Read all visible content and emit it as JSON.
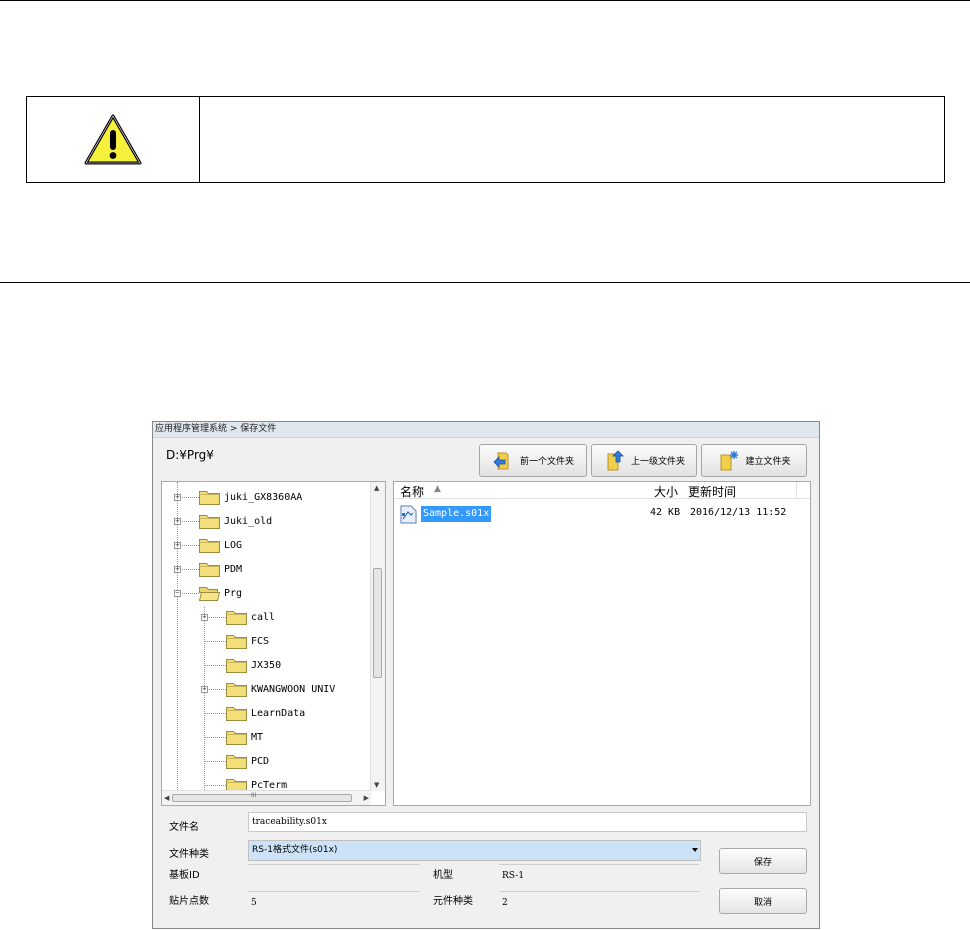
{
  "dialog": {
    "title": "应用程序管理系统 > 保存文件",
    "current_path": "D:¥Prg¥",
    "toolbar": {
      "back_label": "前一个文件夹",
      "up_label": "上一级文件夹",
      "new_folder_label": "建立文件夹"
    },
    "tree": {
      "items": [
        {
          "label": "juki_GX8360AA"
        },
        {
          "label": "Juki_old"
        },
        {
          "label": "LOG"
        },
        {
          "label": "PDM"
        },
        {
          "label": "Prg"
        },
        {
          "label": "call"
        },
        {
          "label": "FCS"
        },
        {
          "label": "JX350"
        },
        {
          "label": "KWANGWOON UNIV"
        },
        {
          "label": "LearnData"
        },
        {
          "label": "MT"
        },
        {
          "label": "PCD"
        },
        {
          "label": "PcTerm"
        }
      ],
      "hscroll_marker": "III"
    },
    "file_list": {
      "columns": {
        "name": "名称",
        "size": "大小",
        "modified": "更新时间"
      },
      "files": [
        {
          "name": "Sample.s01x",
          "size": "42 KB",
          "modified": "2016/12/13 11:52"
        }
      ]
    },
    "form": {
      "filename_label": "文件名",
      "filename_value": "traceability.s01x",
      "filetype_label": "文件种类",
      "filetype_value": "RS-1格式文件(s01x)",
      "board_id_label": "基板ID",
      "board_id_value": "",
      "model_label": "机型",
      "model_value": "RS-1",
      "points_label": "贴片点数",
      "points_value": "5",
      "component_types_label": "元件种类",
      "component_types_value": "2"
    },
    "buttons": {
      "save_label": "保存",
      "cancel_label": "取消"
    }
  },
  "colors": {
    "warning_yellow": "#f5f03c",
    "selection_blue": "#3399ff",
    "select_bg": "#cce3f7",
    "folder_yellow": "#f2df7a"
  }
}
